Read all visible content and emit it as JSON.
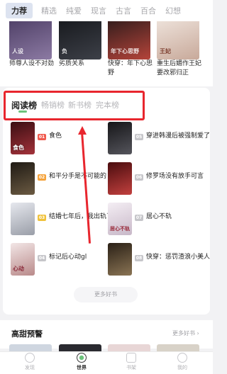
{
  "top_tabs": [
    "力荐",
    "精选",
    "纯爱",
    "现言",
    "古言",
    "百合",
    "幻想"
  ],
  "strip_books": [
    {
      "title": "师尊人设不对劲",
      "cover_text": "人设",
      "color": "#5b4a6e"
    },
    {
      "title": "劣质关系",
      "cover_text": "负",
      "color": "#1f2126"
    },
    {
      "title": "快穿：年下心思野",
      "cover_text": "年下心思野",
      "color": "#6b2a2a"
    },
    {
      "title": "重生后媚作王妃要改邪归正",
      "cover_text": "王妃",
      "color": "#e8d9cf"
    }
  ],
  "rank_tabs": [
    "阅读榜",
    "畅销榜",
    "新书榜",
    "完本榜"
  ],
  "rank_books": [
    {
      "rank": "01",
      "title": "食色",
      "cover_text": "食色",
      "color": "#7a2025",
      "badge_color": "#f05a4e"
    },
    {
      "rank": "02",
      "title": "和平分手是不可能的",
      "cover_text": "",
      "color": "#3a3226",
      "badge_color": "#f5a33b"
    },
    {
      "rank": "03",
      "title": "结婚七年后，我出轨了",
      "cover_text": "",
      "color": "#c7c9cf",
      "badge_color": "#f0c23b"
    },
    {
      "rank": "04",
      "title": "标记后心动gl",
      "cover_text": "心动",
      "color": "#d9c4c4",
      "badge_color": "#c6c6ca"
    },
    {
      "rank": "05",
      "title": "穿进韩漫后被强制爱了",
      "cover_text": "",
      "color": "#2b2b2f",
      "badge_color": "#c6c6ca"
    },
    {
      "rank": "06",
      "title": "修罗场没有放手可言",
      "cover_text": "",
      "color": "#8a1f22",
      "badge_color": "#c6c6ca"
    },
    {
      "rank": "07",
      "title": "居心不轨",
      "cover_text": "居心不轨",
      "color": "#e6dfe6",
      "badge_color": "#c6c6ca"
    },
    {
      "rank": "08",
      "title": "快穿：惩罚渣浪小美人",
      "cover_text": "",
      "color": "#4a3b2c",
      "badge_color": "#c6c6ca"
    }
  ],
  "more_books_label": "更多好书",
  "sweet": {
    "title": "高甜预警",
    "more": "更多好书 ›"
  },
  "bottom_nav": [
    {
      "label": "发现",
      "icon": "discover-icon"
    },
    {
      "label": "世界",
      "icon": "world-icon"
    },
    {
      "label": "书架",
      "icon": "bookshelf-icon"
    },
    {
      "label": "我的",
      "icon": "profile-icon"
    }
  ],
  "colors": {
    "accent_red": "#e8262e",
    "active_green": "#6cc37c"
  }
}
